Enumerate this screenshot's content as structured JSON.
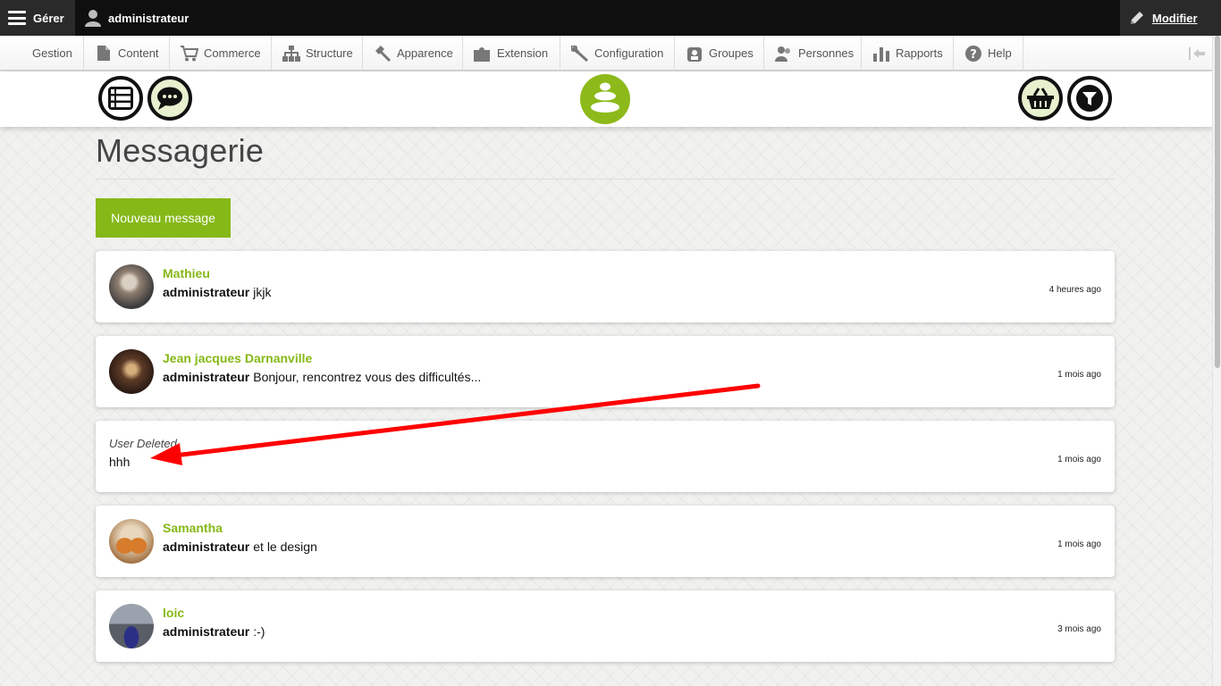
{
  "admin_bar": {
    "manage_label": "Gérer",
    "user_label": "administrateur",
    "edit_label": "Modifier"
  },
  "tray": {
    "items": [
      {
        "label": "Gestion",
        "icon": "none"
      },
      {
        "label": "Content",
        "icon": "file-icon"
      },
      {
        "label": "Commerce",
        "icon": "cart-icon"
      },
      {
        "label": "Structure",
        "icon": "sitemap-icon"
      },
      {
        "label": "Apparence",
        "icon": "brush-icon"
      },
      {
        "label": "Extension",
        "icon": "puzzle-icon"
      },
      {
        "label": "Configuration",
        "icon": "wrench-icon"
      },
      {
        "label": "Groupes",
        "icon": "group-icon"
      },
      {
        "label": "Personnes",
        "icon": "people-icon"
      },
      {
        "label": "Rapports",
        "icon": "bar-chart-icon"
      },
      {
        "label": "Help",
        "icon": "help-icon"
      }
    ]
  },
  "header": {
    "left_icons": [
      "list-icon",
      "chat-icon"
    ],
    "logo": "stacked-stones-logo",
    "right_icons": [
      "basket-icon",
      "filter-icon"
    ]
  },
  "page": {
    "title": "Messagerie",
    "new_message_label": "Nouveau message"
  },
  "messages": [
    {
      "name": "Mathieu",
      "author": "administrateur",
      "text": "jkjk",
      "time": "4 heures ago"
    },
    {
      "name": "Jean jacques Darnanville",
      "author": "administrateur",
      "text": "Bonjour, rencontrez vous des difficultés...",
      "time": "1 mois ago"
    },
    {
      "name": "User Deleted",
      "author": "",
      "text": "hhh",
      "time": "1 mois ago"
    },
    {
      "name": "Samantha",
      "author": "administrateur",
      "text": "et le design",
      "time": "1 mois ago"
    },
    {
      "name": "loic",
      "author": "administrateur",
      "text": ":-)",
      "time": "3 mois ago"
    }
  ],
  "colors": {
    "accent": "#86b817",
    "admin_bar": "#0f0f0f",
    "annotation_arrow": "#ff0000"
  }
}
